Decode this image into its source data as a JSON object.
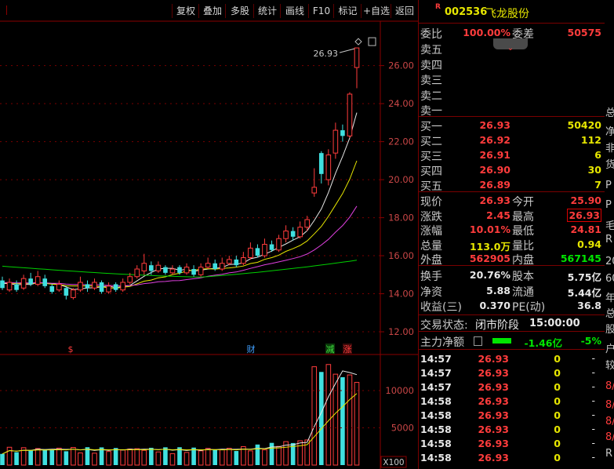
{
  "toolbar": {
    "buttons": [
      "复权",
      "叠加",
      "多股",
      "统计",
      "画线",
      "F10",
      "标记",
      "+自选",
      "返回"
    ]
  },
  "stock": {
    "badge": "R",
    "code": "002536",
    "name": "飞龙股份"
  },
  "quote": {
    "weibi_label": "委比",
    "weibi_value": "100.00%",
    "weicha_label": "委差",
    "weicha_value": "50575",
    "sell_labels": [
      "卖五",
      "卖四",
      "卖三",
      "卖二",
      "卖一"
    ],
    "buy": [
      {
        "label": "买一",
        "price": "26.93",
        "vol": "50420"
      },
      {
        "label": "买二",
        "price": "26.92",
        "vol": "112"
      },
      {
        "label": "买三",
        "price": "26.91",
        "vol": "6"
      },
      {
        "label": "买四",
        "price": "26.90",
        "vol": "30"
      },
      {
        "label": "买五",
        "price": "26.89",
        "vol": "7"
      }
    ],
    "stats": [
      {
        "l1": "现价",
        "v1": "26.93",
        "l2": "今开",
        "v2": "25.90"
      },
      {
        "l1": "涨跌",
        "v1": "2.45",
        "l2": "最高",
        "v2": "26.93"
      },
      {
        "l1": "涨幅",
        "v1": "10.01%",
        "l2": "最低",
        "v2": "24.81"
      },
      {
        "l1": "总量",
        "v1": "113.0万",
        "l2": "量比",
        "v2": "0.94"
      },
      {
        "l1": "外盘",
        "v1": "562905",
        "l2": "内盘",
        "v2": "567145"
      }
    ],
    "stats2": [
      {
        "l1": "换手",
        "v1": "20.76%",
        "l2": "股本",
        "v2": "5.75亿"
      },
      {
        "l1": "净资",
        "v1": "5.88",
        "l2": "流通",
        "v2": "5.44亿"
      },
      {
        "l1": "收益(三)",
        "v1": "0.370",
        "l2": "PE(动)",
        "v2": "36.8"
      }
    ],
    "trade_status_label": "交易状态:",
    "trade_status_value": "闭市阶段",
    "trade_status_time": "15:00:00",
    "main_force_label": "主力净额",
    "main_force_value": "-1.46亿",
    "main_force_pct": "-5%"
  },
  "ticks": [
    {
      "time": "14:57",
      "price": "26.93",
      "vol": "0",
      "dir": "-"
    },
    {
      "time": "14:57",
      "price": "26.93",
      "vol": "0",
      "dir": "-"
    },
    {
      "time": "14:57",
      "price": "26.93",
      "vol": "0",
      "dir": "-"
    },
    {
      "time": "14:58",
      "price": "26.93",
      "vol": "0",
      "dir": "-"
    },
    {
      "time": "14:58",
      "price": "26.93",
      "vol": "0",
      "dir": "-"
    },
    {
      "time": "14:58",
      "price": "26.93",
      "vol": "0",
      "dir": "-"
    },
    {
      "time": "14:58",
      "price": "26.93",
      "vol": "0",
      "dir": "-"
    },
    {
      "time": "14:58",
      "price": "26.93",
      "vol": "0",
      "dir": "-"
    }
  ],
  "strip_chars": [
    "总",
    "净",
    "非",
    "货",
    "P",
    "P",
    "毛",
    "R",
    "20",
    "60",
    "年",
    "总",
    "股",
    "户",
    "较",
    "8/",
    "8/",
    "8/",
    "8/",
    "R"
  ],
  "chart_data": [
    {
      "type": "candlestick",
      "price_axis_ticks": [
        "26.00",
        "24.00",
        "22.00",
        "20.00",
        "18.00",
        "16.00",
        "14.00",
        "12.00"
      ],
      "ylim": [
        11.3,
        27.8
      ],
      "high_label": "26.93",
      "markers": [
        "$",
        "财",
        "减",
        "涨"
      ],
      "candles": [
        {
          "o": 14.7,
          "c": 14.3,
          "h": 14.9,
          "l": 14.2,
          "up": false
        },
        {
          "o": 14.2,
          "c": 14.6,
          "h": 14.8,
          "l": 14.1,
          "up": true
        },
        {
          "o": 14.5,
          "c": 14.2,
          "h": 14.7,
          "l": 14.1,
          "up": false
        },
        {
          "o": 14.3,
          "c": 14.8,
          "h": 15.0,
          "l": 14.2,
          "up": true
        },
        {
          "o": 14.8,
          "c": 14.5,
          "h": 15.1,
          "l": 14.4,
          "up": false
        },
        {
          "o": 14.5,
          "c": 14.9,
          "h": 15.2,
          "l": 14.4,
          "up": true
        },
        {
          "o": 14.8,
          "c": 14.4,
          "h": 15.0,
          "l": 14.3,
          "up": false
        },
        {
          "o": 14.4,
          "c": 14.1,
          "h": 14.5,
          "l": 14.0,
          "up": false
        },
        {
          "o": 14.2,
          "c": 14.5,
          "h": 14.7,
          "l": 14.1,
          "up": true
        },
        {
          "o": 14.3,
          "c": 13.9,
          "h": 14.4,
          "l": 13.7,
          "up": false
        },
        {
          "o": 13.8,
          "c": 14.2,
          "h": 14.3,
          "l": 13.7,
          "up": true
        },
        {
          "o": 14.2,
          "c": 14.6,
          "h": 14.9,
          "l": 14.1,
          "up": true
        },
        {
          "o": 14.5,
          "c": 14.3,
          "h": 14.7,
          "l": 14.1,
          "up": false
        },
        {
          "o": 14.3,
          "c": 14.6,
          "h": 14.8,
          "l": 14.2,
          "up": true
        },
        {
          "o": 14.6,
          "c": 14.1,
          "h": 14.7,
          "l": 14.0,
          "up": false
        },
        {
          "o": 14.1,
          "c": 14.4,
          "h": 14.6,
          "l": 14.0,
          "up": true
        },
        {
          "o": 14.5,
          "c": 14.2,
          "h": 14.6,
          "l": 14.1,
          "up": false
        },
        {
          "o": 14.2,
          "c": 14.6,
          "h": 14.8,
          "l": 14.1,
          "up": true
        },
        {
          "o": 14.6,
          "c": 14.9,
          "h": 15.1,
          "l": 14.5,
          "up": true
        },
        {
          "o": 14.9,
          "c": 15.3,
          "h": 15.5,
          "l": 14.8,
          "up": true
        },
        {
          "o": 15.2,
          "c": 15.6,
          "h": 16.1,
          "l": 15.0,
          "up": true
        },
        {
          "o": 15.5,
          "c": 15.2,
          "h": 15.7,
          "l": 15.0,
          "up": false
        },
        {
          "o": 15.2,
          "c": 15.5,
          "h": 15.7,
          "l": 15.1,
          "up": true
        },
        {
          "o": 15.4,
          "c": 15.1,
          "h": 15.5,
          "l": 15.0,
          "up": false
        },
        {
          "o": 15.1,
          "c": 15.3,
          "h": 15.5,
          "l": 15.0,
          "up": true
        },
        {
          "o": 15.4,
          "c": 15.1,
          "h": 15.5,
          "l": 15.0,
          "up": false
        },
        {
          "o": 15.1,
          "c": 15.4,
          "h": 15.6,
          "l": 15.0,
          "up": true
        },
        {
          "o": 15.3,
          "c": 15.0,
          "h": 15.5,
          "l": 14.9,
          "up": false
        },
        {
          "o": 15.0,
          "c": 15.4,
          "h": 15.6,
          "l": 14.9,
          "up": true
        },
        {
          "o": 15.4,
          "c": 15.6,
          "h": 15.9,
          "l": 15.3,
          "up": true
        },
        {
          "o": 15.6,
          "c": 15.3,
          "h": 15.8,
          "l": 15.2,
          "up": false
        },
        {
          "o": 15.3,
          "c": 15.6,
          "h": 15.9,
          "l": 15.2,
          "up": true
        },
        {
          "o": 15.6,
          "c": 15.8,
          "h": 16.0,
          "l": 15.5,
          "up": true
        },
        {
          "o": 15.8,
          "c": 15.5,
          "h": 16.0,
          "l": 15.4,
          "up": false
        },
        {
          "o": 15.6,
          "c": 15.9,
          "h": 16.2,
          "l": 15.5,
          "up": true
        },
        {
          "o": 15.9,
          "c": 16.4,
          "h": 16.7,
          "l": 15.8,
          "up": true
        },
        {
          "o": 16.4,
          "c": 16.0,
          "h": 16.6,
          "l": 15.9,
          "up": false
        },
        {
          "o": 16.0,
          "c": 16.6,
          "h": 16.9,
          "l": 15.9,
          "up": true
        },
        {
          "o": 16.6,
          "c": 16.3,
          "h": 16.8,
          "l": 16.2,
          "up": false
        },
        {
          "o": 16.3,
          "c": 16.9,
          "h": 17.1,
          "l": 16.2,
          "up": true
        },
        {
          "o": 16.9,
          "c": 17.3,
          "h": 17.6,
          "l": 16.7,
          "up": true
        },
        {
          "o": 17.3,
          "c": 17.0,
          "h": 17.5,
          "l": 16.8,
          "up": false
        },
        {
          "o": 17.0,
          "c": 17.5,
          "h": 17.8,
          "l": 16.9,
          "up": true
        },
        {
          "o": 17.5,
          "c": 17.9,
          "h": 18.1,
          "l": 17.3,
          "up": true
        },
        {
          "o": 19.3,
          "c": 19.6,
          "h": 20.6,
          "l": 19.1,
          "up": true
        },
        {
          "o": 21.4,
          "c": 20.3,
          "h": 21.5,
          "l": 19.8,
          "up": false
        },
        {
          "o": 20.0,
          "c": 21.3,
          "h": 21.6,
          "l": 19.7,
          "up": true
        },
        {
          "o": 21.4,
          "c": 22.6,
          "h": 23.0,
          "l": 21.1,
          "up": true
        },
        {
          "o": 22.6,
          "c": 22.3,
          "h": 22.9,
          "l": 22.0,
          "up": false
        },
        {
          "o": 22.3,
          "c": 24.5,
          "h": 24.6,
          "l": 22.2,
          "up": true
        },
        {
          "o": 25.9,
          "c": 26.93,
          "h": 26.93,
          "l": 24.81,
          "up": true
        }
      ]
    },
    {
      "type": "bar",
      "title": "volume",
      "axis_ticks": [
        "10000",
        "5000"
      ],
      "unit_label": "X100",
      "ylim": [
        0,
        14000
      ]
    }
  ]
}
